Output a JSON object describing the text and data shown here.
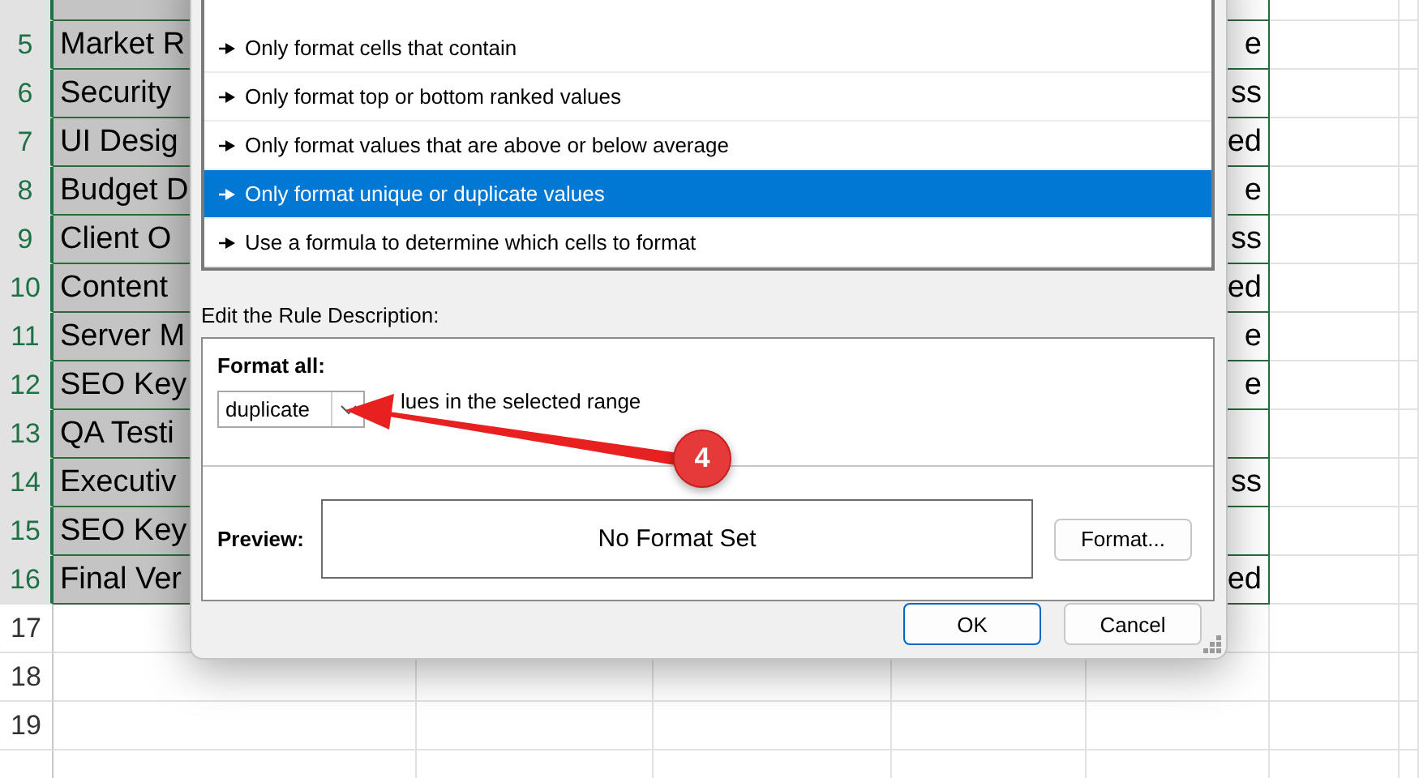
{
  "sheet": {
    "rows": [
      {
        "selected": true
      },
      {
        "number": "5",
        "selected": true,
        "column_1": "Market R",
        "column_5": "e"
      },
      {
        "number": "6",
        "selected": true,
        "column_1": "Security",
        "column_5": "ss"
      },
      {
        "number": "7",
        "selected": true,
        "column_1": "UI Desig",
        "column_5": "ed"
      },
      {
        "number": "8",
        "selected": true,
        "column_1": "Budget D",
        "column_5": "e"
      },
      {
        "number": "9",
        "selected": true,
        "column_1": "Client O",
        "column_5": "ss"
      },
      {
        "number": "10",
        "selected": true,
        "column_1": "Content",
        "column_5": "ed"
      },
      {
        "number": "11",
        "selected": true,
        "column_1": "Server M",
        "column_5": "e"
      },
      {
        "number": "12",
        "selected": true,
        "column_1": "SEO Key",
        "column_5": "e"
      },
      {
        "number": "13",
        "selected": true,
        "column_1": "QA Testi"
      },
      {
        "number": "14",
        "selected": true,
        "column_1": "Executiv",
        "column_5": "ss"
      },
      {
        "number": "15",
        "selected": true,
        "column_1": "SEO Key"
      },
      {
        "number": "16",
        "selected": true,
        "column_1": "Final Ver",
        "column_5": "ed"
      },
      {
        "number": "17",
        "selected": false
      },
      {
        "number": "18",
        "selected": false
      },
      {
        "number": "19",
        "selected": false
      },
      {
        "selected": false
      }
    ]
  },
  "dialog": {
    "rule_types": [
      {
        "label": "Only format cells that contain",
        "selected": false
      },
      {
        "label": "Only format top or bottom ranked values",
        "selected": false
      },
      {
        "label": "Only format values that are above or below average",
        "selected": false
      },
      {
        "label": "Only format unique or duplicate values",
        "selected": true
      },
      {
        "label": "Use a formula to determine which cells to format",
        "selected": false
      }
    ],
    "description_label": "Edit the Rule Description:",
    "format_all_label": "Format all:",
    "dropdown": {
      "value": "duplicate"
    },
    "dropdown_suffix": "lues in the selected range",
    "preview_label": "Preview:",
    "preview_text": "No Format Set",
    "format_button": "Format...",
    "buttons": [
      {
        "label": "OK",
        "default": true
      },
      {
        "label": "Cancel",
        "default": false
      }
    ]
  },
  "annotation": {
    "step": "4"
  }
}
